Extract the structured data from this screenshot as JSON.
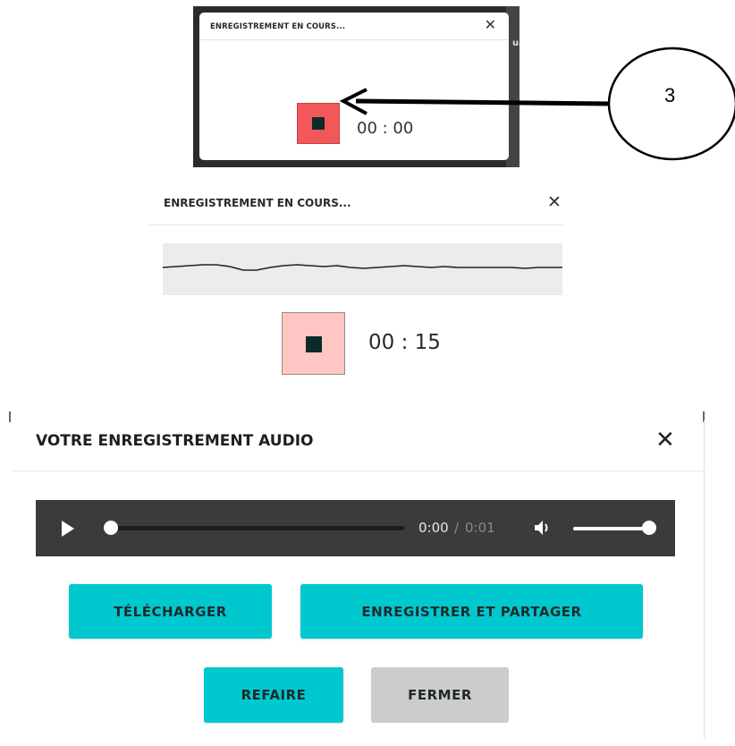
{
  "panel_initial": {
    "title": "ENREGISTREMENT EN COURS...",
    "close_glyph": "✕",
    "timer": "00 : 00",
    "background_fragment": "ua",
    "stop_color": "#f2575a"
  },
  "annotation": {
    "number": "3"
  },
  "panel_recording": {
    "title": "ENREGISTREMENT EN COURS...",
    "close_glyph": "✕",
    "timer": "00 : 15",
    "stop_color": "#ffc6c4"
  },
  "panel_playback": {
    "title": "VOTRE ENREGISTREMENT AUDIO",
    "close_glyph": "✕",
    "player": {
      "current_time": "0:00",
      "separator": "/",
      "duration": "0:01",
      "progress": 0,
      "volume": 1.0
    },
    "buttons": {
      "download": "TÉLÉCHARGER",
      "save_share": "ENREGISTRER ET PARTAGER",
      "redo": "REFAIRE",
      "close": "FERMER"
    },
    "accent_color": "#00c8cf"
  },
  "icons": [
    "close-icon",
    "stop-icon",
    "play-icon",
    "volume-icon",
    "arrow-icon"
  ]
}
